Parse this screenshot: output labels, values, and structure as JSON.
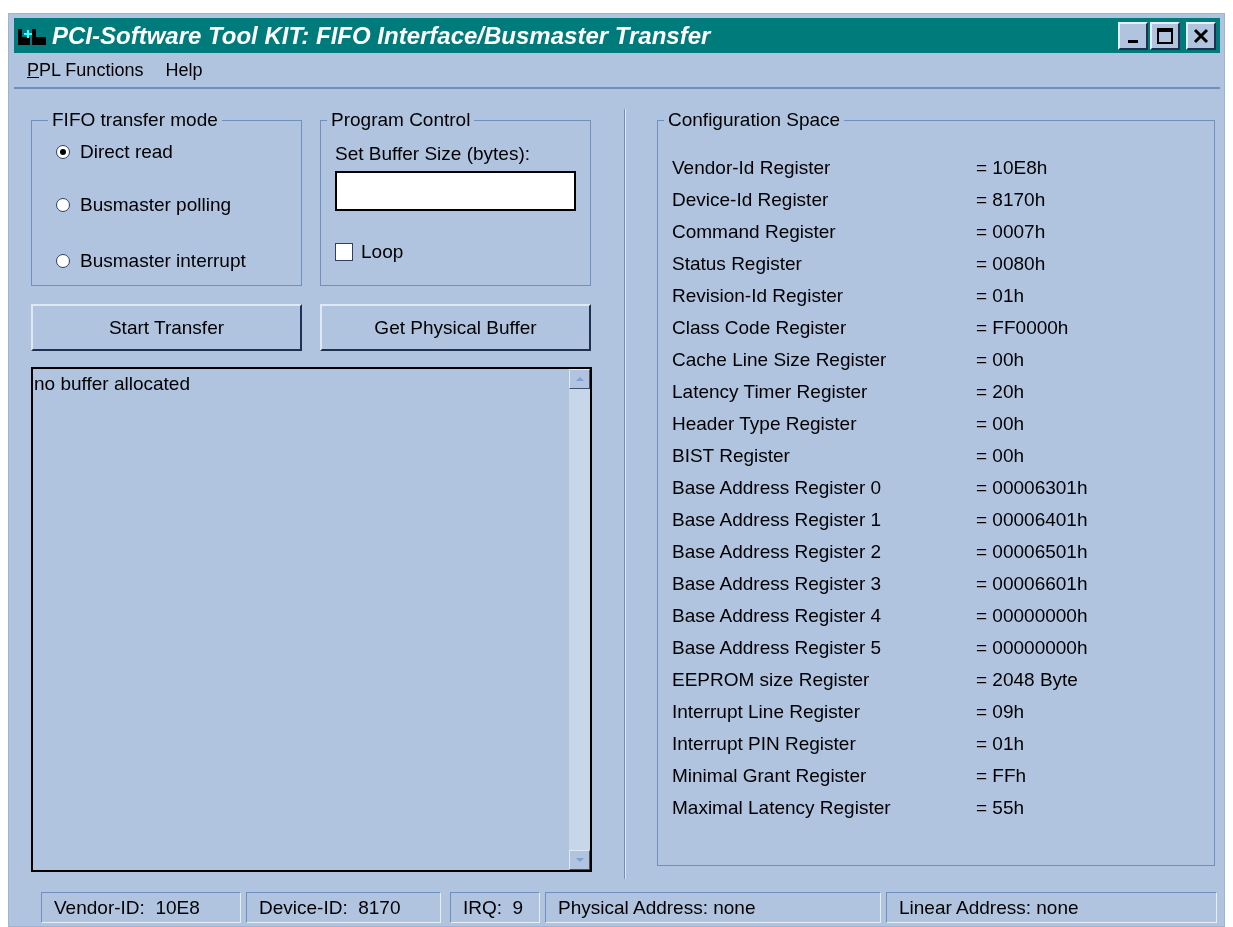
{
  "window": {
    "title": "PCI-Software Tool KIT: FIFO Interface/Busmaster Transfer"
  },
  "menu": [
    {
      "label": "PPL Functions",
      "access_key_underlined": true
    },
    {
      "label": "Help",
      "access_key_underlined": false
    }
  ],
  "fifo_transfer_mode": {
    "title": "FIFO transfer mode",
    "options": [
      {
        "label": "Direct read",
        "selected": true
      },
      {
        "label": "Busmaster polling",
        "selected": false
      },
      {
        "label": "Busmaster interrupt",
        "selected": false
      }
    ]
  },
  "program_control": {
    "title": "Program Control",
    "buffer_size_label": "Set Buffer Size (bytes):",
    "loop": {
      "label": "Loop",
      "checked": false
    }
  },
  "buttons": [
    "Start Transfer",
    "Get Physical Buffer"
  ],
  "output": {
    "text": "no buffer allocated"
  },
  "configuration_space": {
    "title": "Configuration Space",
    "rows": [
      {
        "label": "Vendor-Id Register",
        "value": "= 10E8h"
      },
      {
        "label": "Device-Id Register",
        "value": "= 8170h"
      },
      {
        "label": "Command Register",
        "value": "= 0007h"
      },
      {
        "label": "Status Register",
        "value": "= 0080h"
      },
      {
        "label": "Revision-Id Register",
        "value": "= 01h"
      },
      {
        "label": "Class Code Register",
        "value": "= FF0000h"
      },
      {
        "label": "Cache Line Size Register",
        "value": "= 00h"
      },
      {
        "label": "Latency Timer Register",
        "value": "= 20h"
      },
      {
        "label": "Header Type Register",
        "value": "= 00h"
      },
      {
        "label": "BIST Register",
        "value": "= 00h"
      },
      {
        "label": "Base Address Register 0",
        "value": "= 00006301h"
      },
      {
        "label": "Base Address Register 1",
        "value": "= 00006401h"
      },
      {
        "label": "Base Address Register 2",
        "value": "= 00006501h"
      },
      {
        "label": "Base Address Register 3",
        "value": "= 00006601h"
      },
      {
        "label": "Base Address Register 4",
        "value": "= 00000000h"
      },
      {
        "label": "Base Address Register 5",
        "value": "= 00000000h"
      },
      {
        "label": "EEPROM size Register",
        "value": "= 2048 Byte"
      },
      {
        "label": "Interrupt Line Register",
        "value": "= 09h"
      },
      {
        "label": "Interrupt PIN Register",
        "value": "= 01h"
      },
      {
        "label": "Minimal Grant Register",
        "value": "= FFh"
      },
      {
        "label": "Maximal Latency Register",
        "value": "= 55h"
      }
    ]
  },
  "status_bar": [
    "Vendor-ID:  10E8",
    "Device-ID:  8170",
    "IRQ:  9",
    "Physical Address: none",
    "Linear Address: none"
  ]
}
